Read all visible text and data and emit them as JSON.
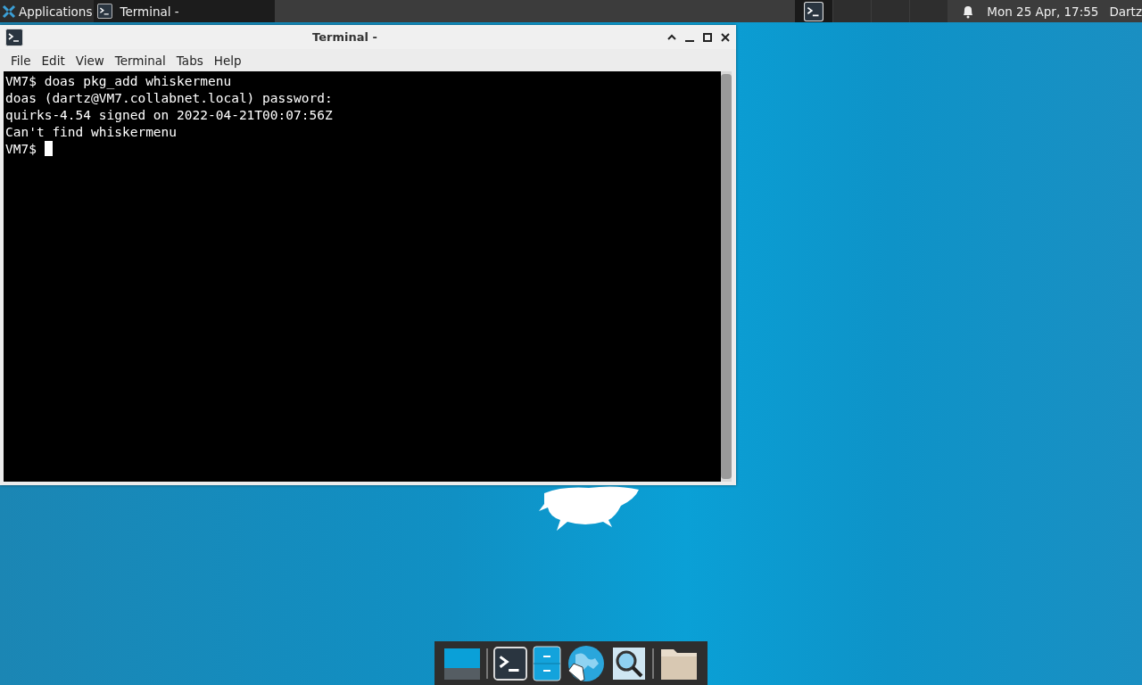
{
  "panel": {
    "menu_label": "Applications",
    "tasks": [
      {
        "label": "Terminal -",
        "selected": true
      }
    ],
    "workspaces": [
      {
        "selected": true,
        "has_window": true
      },
      {
        "selected": false,
        "has_window": false
      },
      {
        "selected": false,
        "has_window": false
      },
      {
        "selected": false,
        "has_window": false
      }
    ],
    "clock": "Mon 25 Apr, 17:55",
    "user": "Dartz"
  },
  "window": {
    "title": "Terminal -",
    "menu": [
      "File",
      "Edit",
      "View",
      "Terminal",
      "Tabs",
      "Help"
    ],
    "lines": [
      "VM7$ doas pkg_add whiskermenu",
      "doas (dartz@VM7.collabnet.local) password:",
      "quirks-4.54 signed on 2022-04-21T00:07:56Z",
      "Can't find whiskermenu"
    ],
    "prompt": "VM7$ "
  },
  "dock": [
    {
      "kind": "desktop"
    },
    {
      "kind": "separator"
    },
    {
      "kind": "terminal"
    },
    {
      "kind": "files"
    },
    {
      "kind": "browser"
    },
    {
      "kind": "search"
    },
    {
      "kind": "separator"
    },
    {
      "kind": "folder"
    }
  ]
}
